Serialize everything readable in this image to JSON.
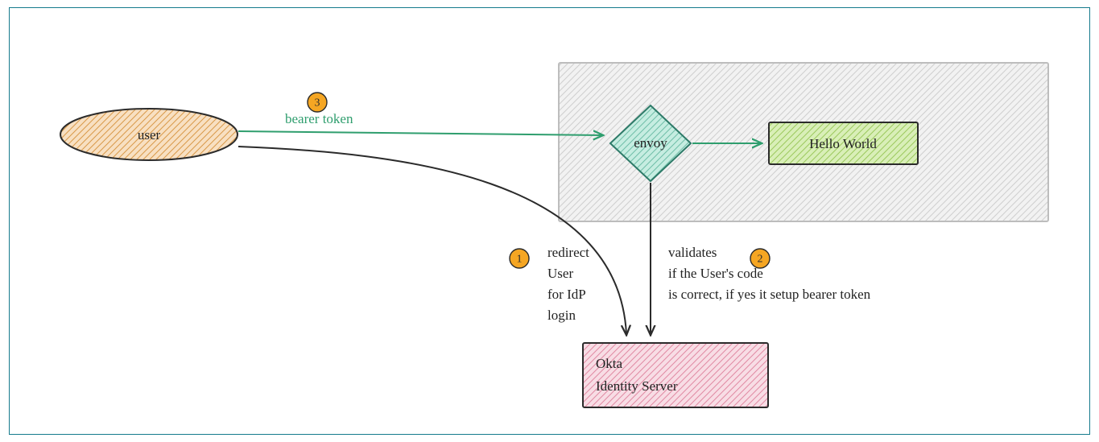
{
  "diagram": {
    "nodes": {
      "user": {
        "label": "user"
      },
      "envoy": {
        "label": "envoy"
      },
      "hello": {
        "label": "Hello World"
      },
      "okta": {
        "line1": "Okta",
        "line2": "Identity Server"
      },
      "container": {
        "label": ""
      }
    },
    "edges": {
      "bearer": {
        "label": "bearer token"
      },
      "redirect": {
        "line1": "redirect",
        "line2": "User",
        "line3": "for IdP",
        "line4": "login"
      },
      "validates": {
        "line1": "validates",
        "line2": "if the User's code",
        "line3": "is correct, if yes it setup bearer token"
      },
      "envoy_to_hello": {
        "label": ""
      }
    },
    "badges": {
      "b1": "1",
      "b2": "2",
      "b3": "3"
    },
    "colors": {
      "user_fill": "#f3c38f",
      "user_stroke": "#2b2b2b",
      "envoy_fill": "#8fd8c6",
      "envoy_stroke": "#2d7a68",
      "hello_fill": "#b9e07f",
      "hello_stroke": "#2b2b2b",
      "okta_fill": "#f3b6c6",
      "okta_stroke": "#2b2b2b",
      "container_fill": "#eaeaea",
      "container_stroke": "#bdbdbd",
      "badge_fill": "#f5a623",
      "green_arrow": "#2f9e6e",
      "black_arrow": "#2b2b2b",
      "frame": "#157a8c"
    }
  }
}
